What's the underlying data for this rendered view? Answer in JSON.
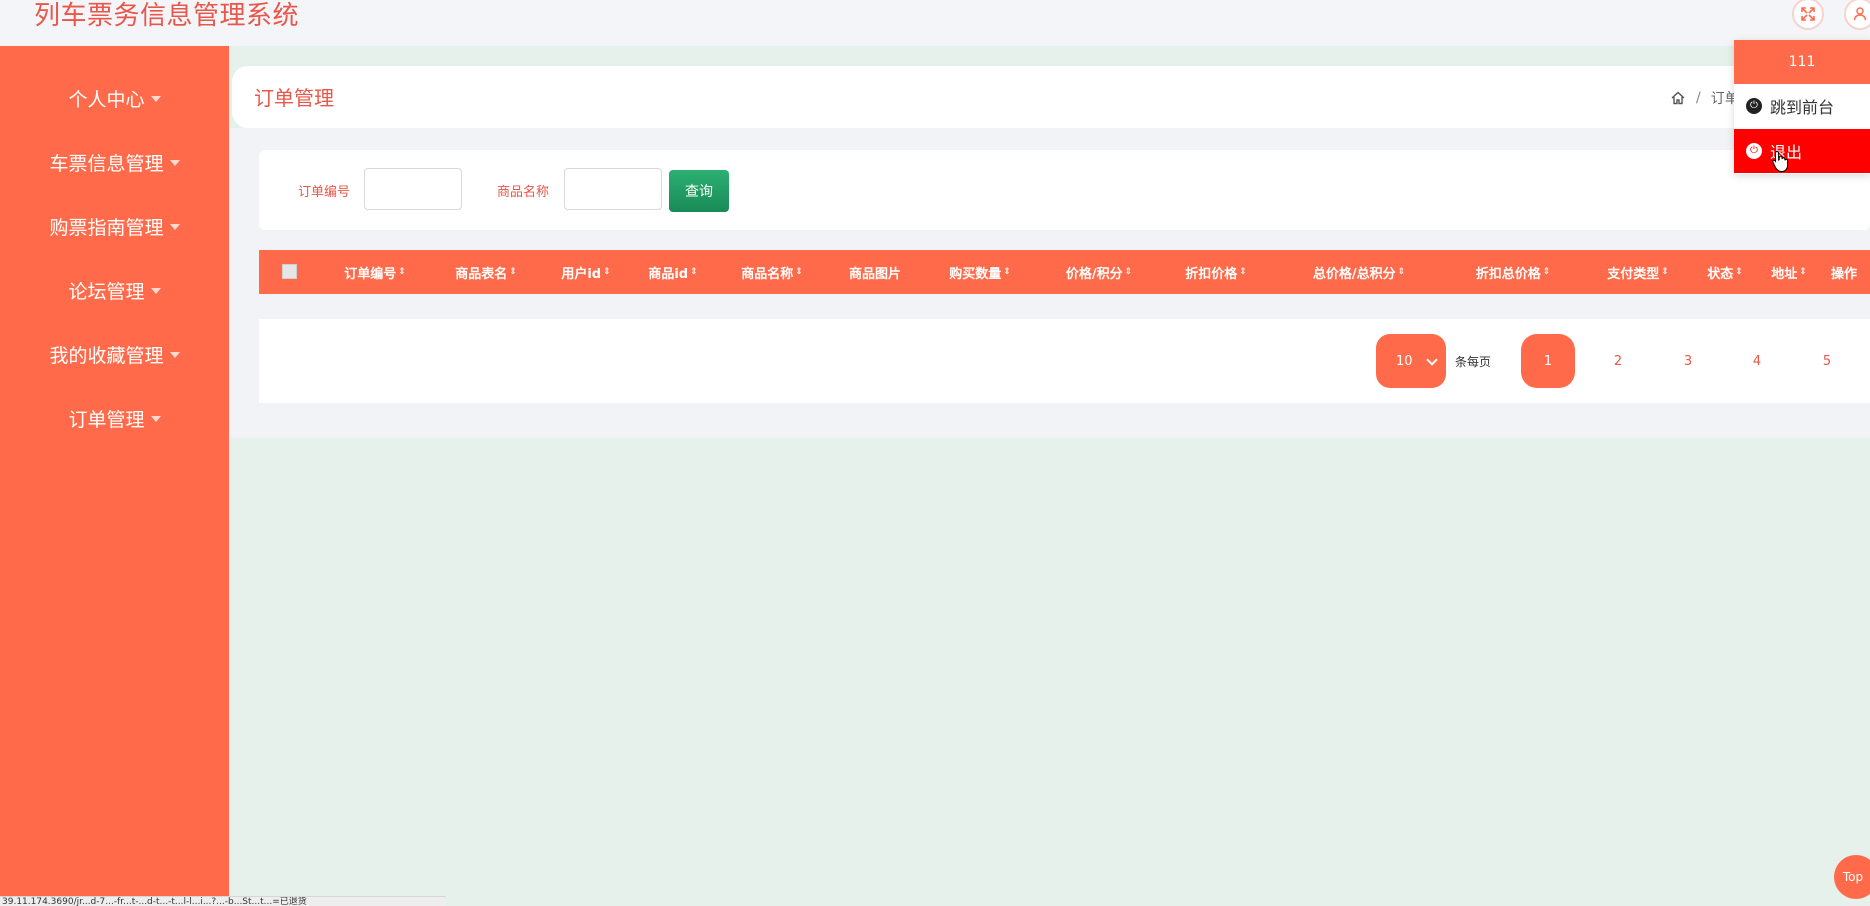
{
  "app": {
    "title": "列车票务信息管理系统"
  },
  "topbar": {
    "fullscreen_icon": "expand-icon",
    "user_icon": "user-icon"
  },
  "sidebar": {
    "items": [
      {
        "label": "个人中心"
      },
      {
        "label": "车票信息管理"
      },
      {
        "label": "购票指南管理"
      },
      {
        "label": "论坛管理"
      },
      {
        "label": "我的收藏管理"
      },
      {
        "label": "订单管理"
      }
    ]
  },
  "header": {
    "title": "订单管理",
    "breadcrumb": {
      "sep": "/",
      "current": "订单"
    }
  },
  "search": {
    "order_no_label": "订单编号",
    "goods_name_label": "商品名称",
    "order_no_value": "",
    "goods_name_value": "",
    "button_label": "查询"
  },
  "table": {
    "columns": [
      {
        "label": "订单编号",
        "sort": true
      },
      {
        "label": "商品表名",
        "sort": true
      },
      {
        "label": "用户id",
        "sort": true
      },
      {
        "label": "商品id",
        "sort": true
      },
      {
        "label": "商品名称",
        "sort": true
      },
      {
        "label": "商品图片",
        "sort": false
      },
      {
        "label": "购买数量",
        "sort": true
      },
      {
        "label": "价格/积分",
        "sort": true
      },
      {
        "label": "折扣价格",
        "sort": true
      },
      {
        "label": "总价格/总积分",
        "sort": true
      },
      {
        "label": "折扣总价格",
        "sort": true
      },
      {
        "label": "支付类型",
        "sort": true
      },
      {
        "label": "状态",
        "sort": true
      },
      {
        "label": "地址",
        "sort": true
      },
      {
        "label": "操作",
        "sort": false
      }
    ],
    "sort_glyph": "⇕"
  },
  "pagination": {
    "page_size": "10",
    "per_page_label": "条每页",
    "pages": [
      "1",
      "2",
      "3",
      "4",
      "5"
    ],
    "current_page": "1"
  },
  "user_dropdown": {
    "username": "111",
    "front_label": "跳到前台",
    "logout_label": "退出"
  },
  "back_to_top": "Top",
  "statusbar": {
    "text": "39.11.174.3690/jr...d-7...-fr...t-...d-t...-t...l-l...i...?...-b...St...t...=已退货"
  },
  "colors": {
    "accent": "#ff6b4a",
    "title_red": "#e8574a",
    "logout_red": "#ff0000",
    "search_green": "#1a8a57",
    "content_bg": "#e6f1ec"
  }
}
